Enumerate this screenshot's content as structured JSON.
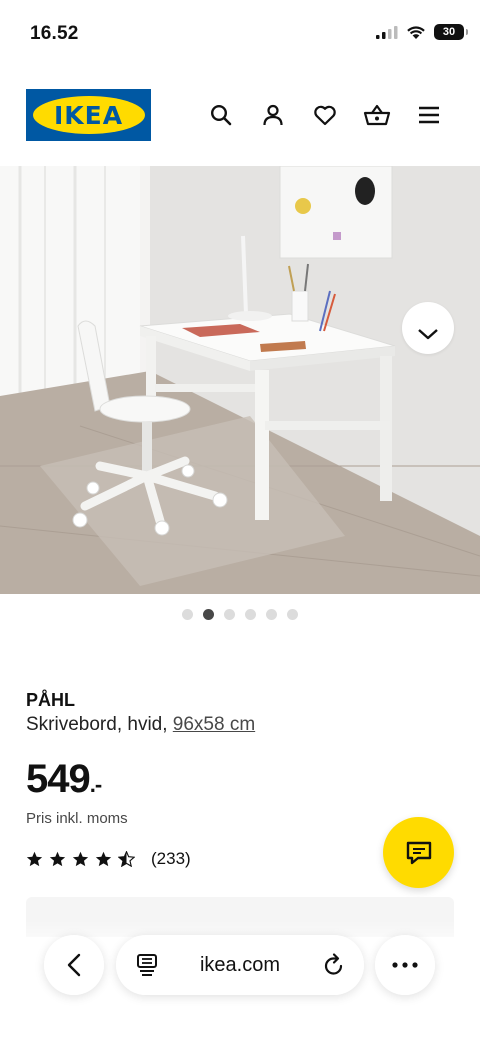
{
  "status_bar": {
    "time": "16.52",
    "battery": "30",
    "icons": [
      "signal-icon",
      "wifi-icon",
      "battery-icon"
    ]
  },
  "header": {
    "logo_text": "IKEA",
    "icons": [
      "search-icon",
      "user-icon",
      "heart-icon",
      "basket-icon",
      "menu-icon"
    ],
    "colors": {
      "brand_blue": "#0058a3",
      "brand_yellow": "#ffdb00"
    }
  },
  "gallery": {
    "image_count": 6,
    "active_index": 1,
    "collapse_icon": "chevron-down-icon"
  },
  "product": {
    "name": "PÅHL",
    "description_prefix": "Skrivebord, hvid, ",
    "measurement": "96x58 cm",
    "price": "549",
    "price_suffix": ".-",
    "price_note": "Pris inkl. moms",
    "rating_value": 4.5,
    "rating_max": 5,
    "review_count": "(233)"
  },
  "chat_button": {
    "icon": "chat-icon"
  },
  "browser": {
    "url": "ikea.com",
    "icons": [
      "back-icon",
      "tabs-icon",
      "reload-icon",
      "more-icon"
    ]
  }
}
